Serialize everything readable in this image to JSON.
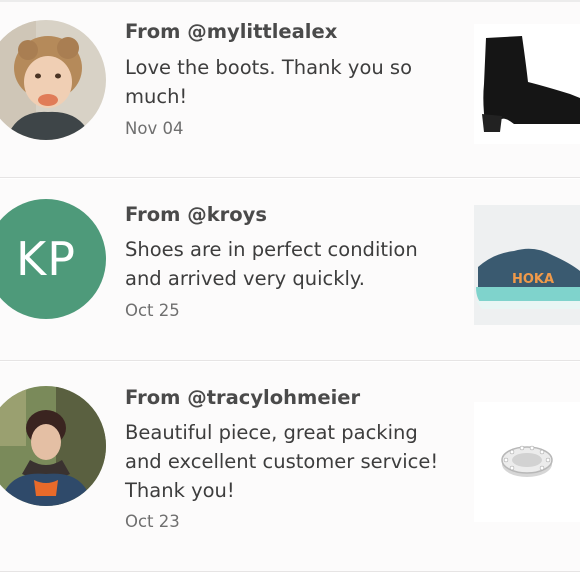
{
  "reviews": [
    {
      "from": "From @mylittlealex",
      "text": "Love the boots. Thank you so much!",
      "date": "Nov 04",
      "avatar_icon": "child-photo-icon",
      "product_icon": "ankle-boot-icon"
    },
    {
      "from": "From @kroys",
      "text": "Shoes are in perfect condition and arrived very quickly.",
      "date": "Oct 25",
      "avatar_initials": "KP",
      "avatar_color": "#4e9a7a",
      "product_icon": "running-shoe-icon",
      "product_brand": "HOKA"
    },
    {
      "from": "From @tracylohmeier",
      "text": "Beautiful piece, great packing and excellent customer service! Thank you!",
      "date": "Oct 23",
      "avatar_icon": "woman-photo-icon",
      "product_icon": "crystal-charm-icon"
    }
  ]
}
